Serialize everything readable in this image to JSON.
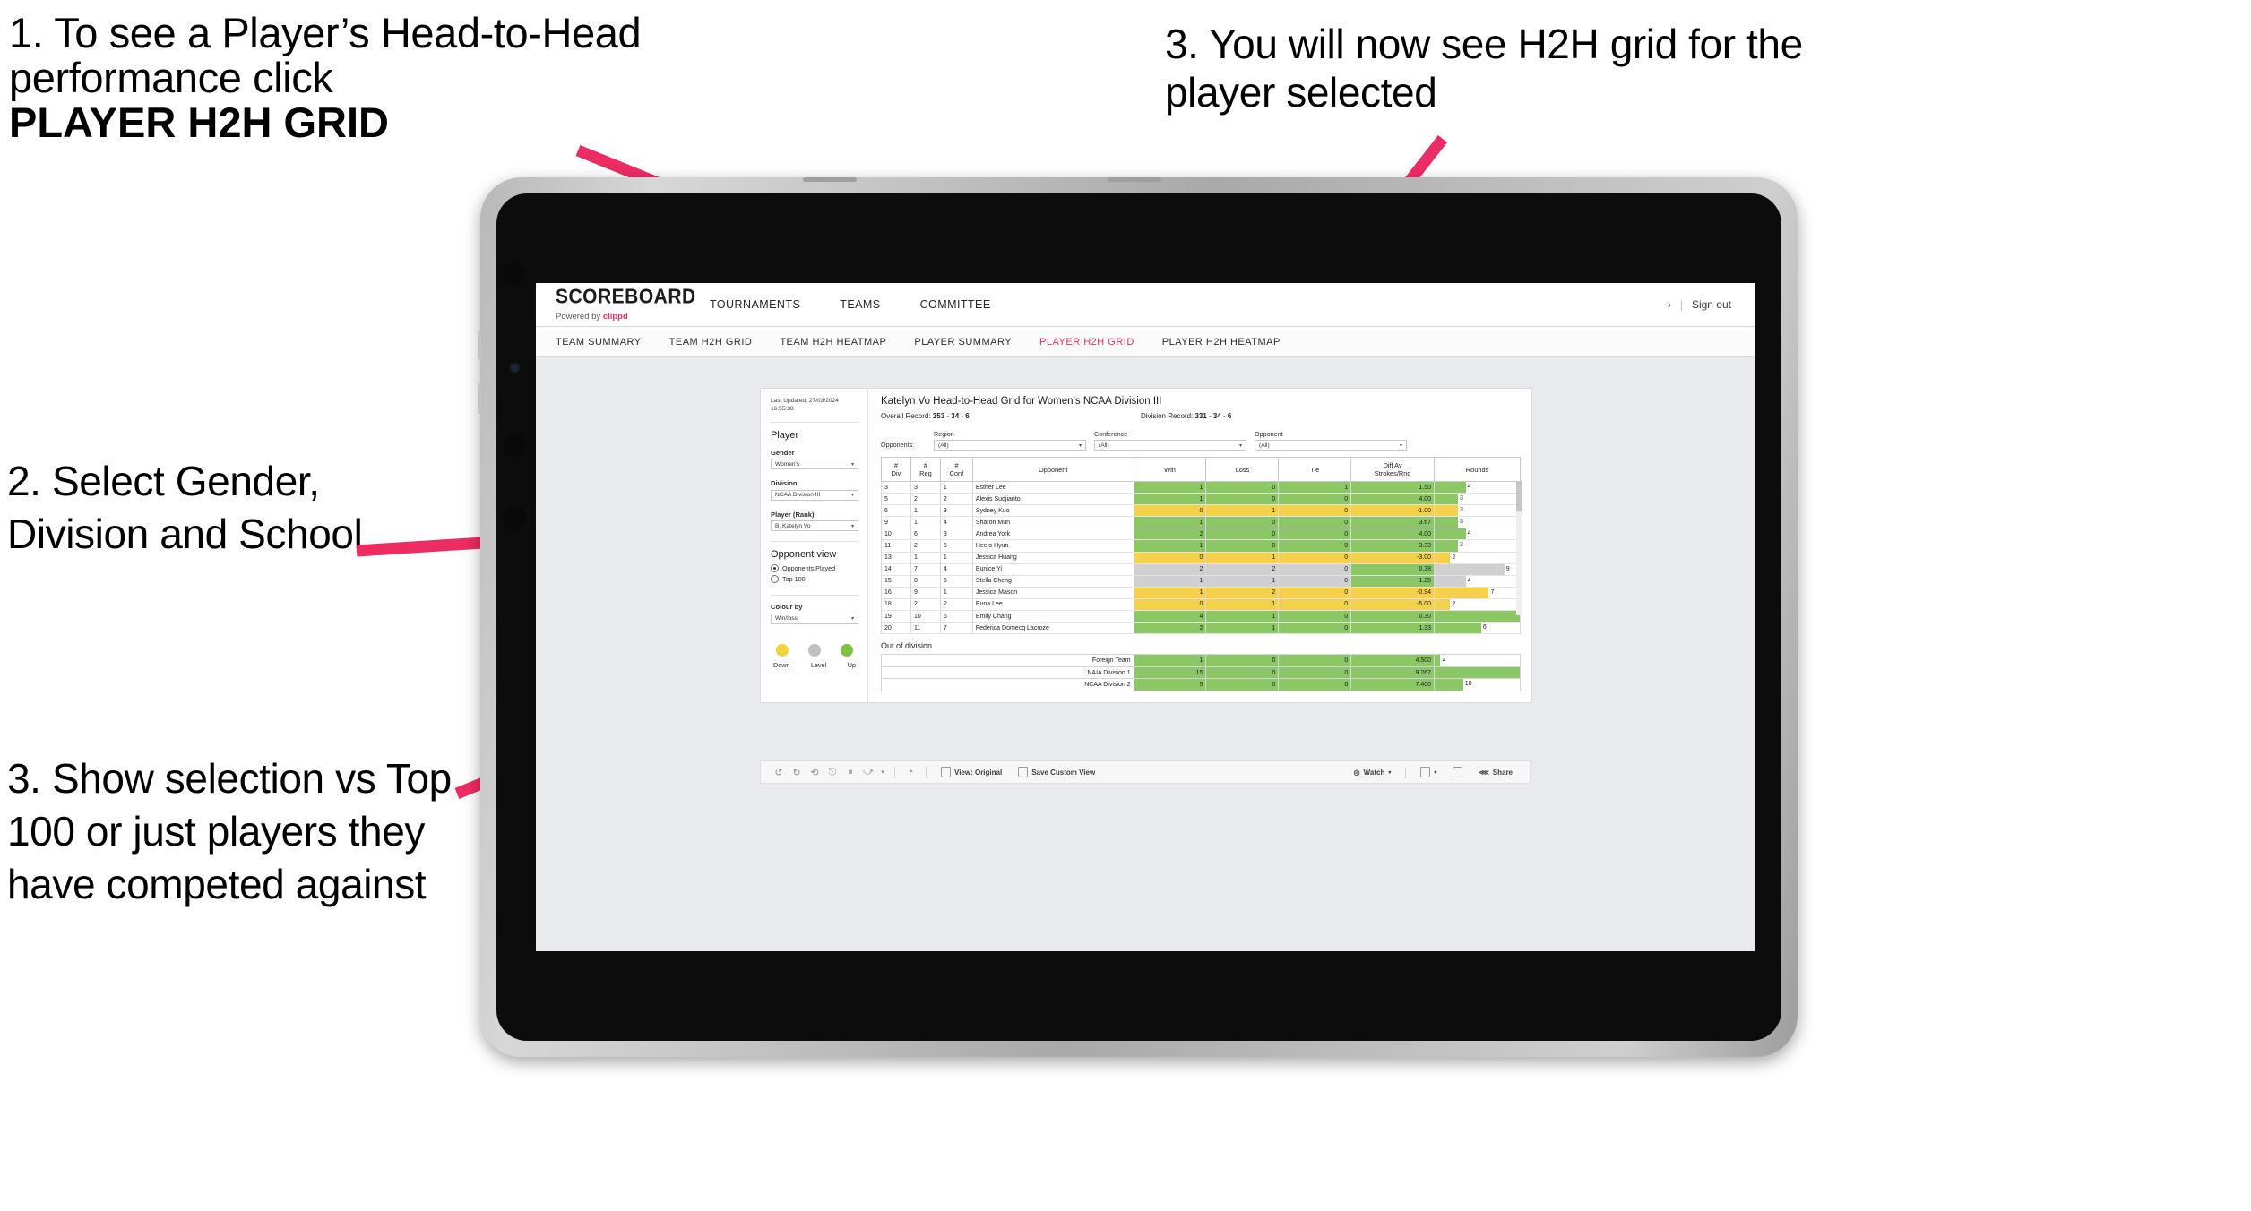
{
  "annotations": {
    "step1_line1": "1. To see a Player’s Head-to-Head performance click ",
    "step1_bold": "PLAYER H2H GRID",
    "step2": "2. Select Gender, Division and School",
    "step3_left": "3. Show selection vs Top 100 or just players they have competed against",
    "step3_right": "3. You will now see H2H grid for the player selected",
    "arrow_color": "#ED2C64"
  },
  "app": {
    "brand": {
      "name": "SCOREBOARD",
      "powered_prefix": "Powered by ",
      "powered_brand": "clippd"
    },
    "topnav": [
      "TOURNAMENTS",
      "TEAMS",
      "COMMITTEE"
    ],
    "topright": {
      "chevron": "›",
      "divider": "|",
      "signout": "Sign out"
    },
    "subtabs": [
      {
        "label": "TEAM SUMMARY",
        "active": false
      },
      {
        "label": "TEAM H2H GRID",
        "active": false
      },
      {
        "label": "TEAM H2H HEATMAP",
        "active": false
      },
      {
        "label": "PLAYER SUMMARY",
        "active": false
      },
      {
        "label": "PLAYER H2H GRID",
        "active": true
      },
      {
        "label": "PLAYER H2H HEATMAP",
        "active": false
      }
    ],
    "accent": "#EF2E63"
  },
  "filters": {
    "last_updated": "Last Updated: 27/03/2024 16:55:38",
    "section_player": "Player",
    "gender": {
      "label": "Gender",
      "value": "Women's"
    },
    "division": {
      "label": "Division",
      "value": "NCAA Division III"
    },
    "player_rank": {
      "label": "Player (Rank)",
      "value": "B. Katelyn Vo"
    },
    "opponent_view": {
      "title": "Opponent view",
      "options": [
        {
          "label": "Opponents Played",
          "selected": true
        },
        {
          "label": "Top 100",
          "selected": false
        }
      ]
    },
    "colour_by": {
      "label": "Colour by",
      "value": "Win/loss"
    },
    "legend": [
      {
        "label": "Down",
        "color": "#F2D340"
      },
      {
        "label": "Level",
        "color": "#BFC0BF"
      },
      {
        "label": "Up",
        "color": "#7DC242"
      }
    ]
  },
  "viz": {
    "title": "Katelyn Vo Head-to-Head Grid for Women’s NCAA Division III",
    "overall_record_label": "Overall Record: ",
    "overall_record_value": "353 - 34 - 6",
    "division_record_label": "Division Record: ",
    "division_record_value": "331 - 34 - 6",
    "opponents_label": "Opponents:",
    "opponent_filters": [
      {
        "label": "Region",
        "value": "(All)"
      },
      {
        "label": "Conference",
        "value": "(All)"
      },
      {
        "label": "Opponent",
        "value": "(All)"
      }
    ],
    "out_of_division_title": "Out of division"
  },
  "chart_data": {
    "type": "table",
    "title": "Katelyn Vo Head-to-Head Grid for Women’s NCAA Division III",
    "columns": [
      "# Div",
      "# Reg",
      "# Conf",
      "Opponent",
      "Win",
      "Loss",
      "Tie",
      "Diff Av Strokes/Rnd",
      "Rounds"
    ],
    "column_header_lines": [
      [
        "#",
        "Div"
      ],
      [
        "#",
        "Reg"
      ],
      [
        "#",
        "Conf"
      ],
      [
        "Opponent"
      ],
      [
        "Win"
      ],
      [
        "Loss"
      ],
      [
        "Tie"
      ],
      [
        "Diff Av",
        "Strokes/Rnd"
      ],
      [
        "Rounds"
      ]
    ],
    "rounds_max": 11,
    "rows": [
      {
        "div": "3",
        "reg": "3",
        "conf": "1",
        "opponent": "Esther Lee",
        "win": "1",
        "loss": "0",
        "tie": "1",
        "diff": "1.50",
        "rounds": "4",
        "state": "up"
      },
      {
        "div": "5",
        "reg": "2",
        "conf": "2",
        "opponent": "Alexis Sudjianto",
        "win": "1",
        "loss": "0",
        "tie": "0",
        "diff": "4.00",
        "rounds": "3",
        "state": "up"
      },
      {
        "div": "6",
        "reg": "1",
        "conf": "3",
        "opponent": "Sydney Kuo",
        "win": "0",
        "loss": "1",
        "tie": "0",
        "diff": "-1.00",
        "rounds": "3",
        "state": "down"
      },
      {
        "div": "9",
        "reg": "1",
        "conf": "4",
        "opponent": "Sharon Mun",
        "win": "1",
        "loss": "0",
        "tie": "0",
        "diff": "3.67",
        "rounds": "3",
        "state": "up"
      },
      {
        "div": "10",
        "reg": "6",
        "conf": "3",
        "opponent": "Andrea York",
        "win": "2",
        "loss": "0",
        "tie": "0",
        "diff": "4.00",
        "rounds": "4",
        "state": "up"
      },
      {
        "div": "11",
        "reg": "2",
        "conf": "5",
        "opponent": "Heejo Hyun",
        "win": "1",
        "loss": "0",
        "tie": "0",
        "diff": "3.33",
        "rounds": "3",
        "state": "up"
      },
      {
        "div": "13",
        "reg": "1",
        "conf": "1",
        "opponent": "Jessica Huang",
        "win": "0",
        "loss": "1",
        "tie": "0",
        "diff": "-3.00",
        "rounds": "2",
        "state": "down"
      },
      {
        "div": "14",
        "reg": "7",
        "conf": "4",
        "opponent": "Eunice Yi",
        "win": "2",
        "loss": "2",
        "tie": "0",
        "diff": "0.38",
        "rounds": "9",
        "state": "level"
      },
      {
        "div": "15",
        "reg": "8",
        "conf": "5",
        "opponent": "Stella Cheng",
        "win": "1",
        "loss": "1",
        "tie": "0",
        "diff": "1.25",
        "rounds": "4",
        "state": "level"
      },
      {
        "div": "16",
        "reg": "9",
        "conf": "1",
        "opponent": "Jessica Mason",
        "win": "1",
        "loss": "2",
        "tie": "0",
        "diff": "-0.94",
        "rounds": "7",
        "state": "down"
      },
      {
        "div": "18",
        "reg": "2",
        "conf": "2",
        "opponent": "Euna Lee",
        "win": "0",
        "loss": "1",
        "tie": "0",
        "diff": "-5.00",
        "rounds": "2",
        "state": "down"
      },
      {
        "div": "19",
        "reg": "10",
        "conf": "6",
        "opponent": "Emily Chang",
        "win": "4",
        "loss": "1",
        "tie": "0",
        "diff": "0.30",
        "rounds": "11",
        "state": "up"
      },
      {
        "div": "20",
        "reg": "11",
        "conf": "7",
        "opponent": "Federica Domecq Lacroze",
        "win": "2",
        "loss": "1",
        "tie": "0",
        "diff": "1.33",
        "rounds": "6",
        "state": "up"
      }
    ],
    "out_of_division": {
      "rounds_max": 30,
      "rows": [
        {
          "name": "Foreign Team",
          "win": "1",
          "loss": "0",
          "tie": "0",
          "diff": "4.500",
          "rounds": "2",
          "state": "up"
        },
        {
          "name": "NAIA Division 1",
          "win": "15",
          "loss": "0",
          "tie": "0",
          "diff": "9.267",
          "rounds": "30",
          "state": "up"
        },
        {
          "name": "NCAA Division 2",
          "win": "5",
          "loss": "0",
          "tie": "0",
          "diff": "7.400",
          "rounds": "10",
          "state": "up"
        }
      ]
    }
  },
  "toolbar": {
    "icons": [
      "undo-icon",
      "redo-icon",
      "revert-icon",
      "refresh-icon",
      "pause-icon",
      "alerts-icon"
    ],
    "view_label": "View: Original",
    "save_label": "Save Custom View",
    "watch_label": "Watch",
    "share_label": "Share"
  }
}
